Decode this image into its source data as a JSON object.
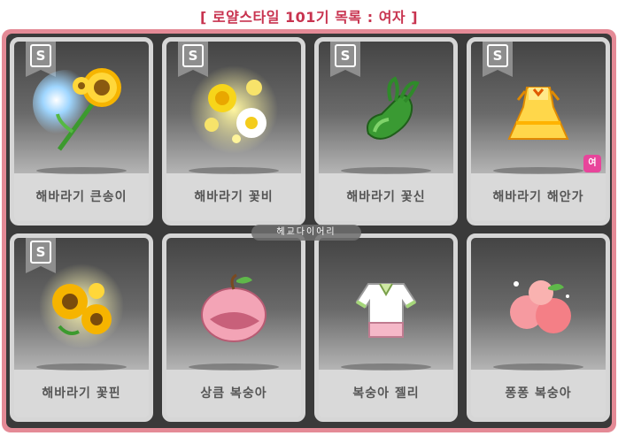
{
  "title": "[ 로얄스타일 101기 목록 : 여자 ]",
  "watermark": "헤교다이어리",
  "colors": {
    "title": "#c8334f",
    "frame": "#e48a96",
    "gender_badge": "#e8459b"
  },
  "items": [
    {
      "name": "해바라기 큰송이",
      "grade": "S",
      "icon": "sunflower-bouquet-icon"
    },
    {
      "name": "해바라기 꽃비",
      "grade": "S",
      "icon": "flower-rain-icon"
    },
    {
      "name": "해바라기 꽃신",
      "grade": "S",
      "icon": "green-shoe-icon"
    },
    {
      "name": "해바라기 해안가",
      "grade": "S",
      "icon": "yellow-dress-icon",
      "badge": "여"
    },
    {
      "name": "해바라기 꽃핀",
      "grade": "S",
      "icon": "sunflower-pin-icon"
    },
    {
      "name": "상큼 복숭아",
      "grade": "",
      "icon": "peach-hat-icon"
    },
    {
      "name": "복숭아 젤리",
      "grade": "",
      "icon": "jelly-outfit-icon"
    },
    {
      "name": "퐁퐁 복숭아",
      "grade": "",
      "icon": "peaches-icon"
    }
  ]
}
